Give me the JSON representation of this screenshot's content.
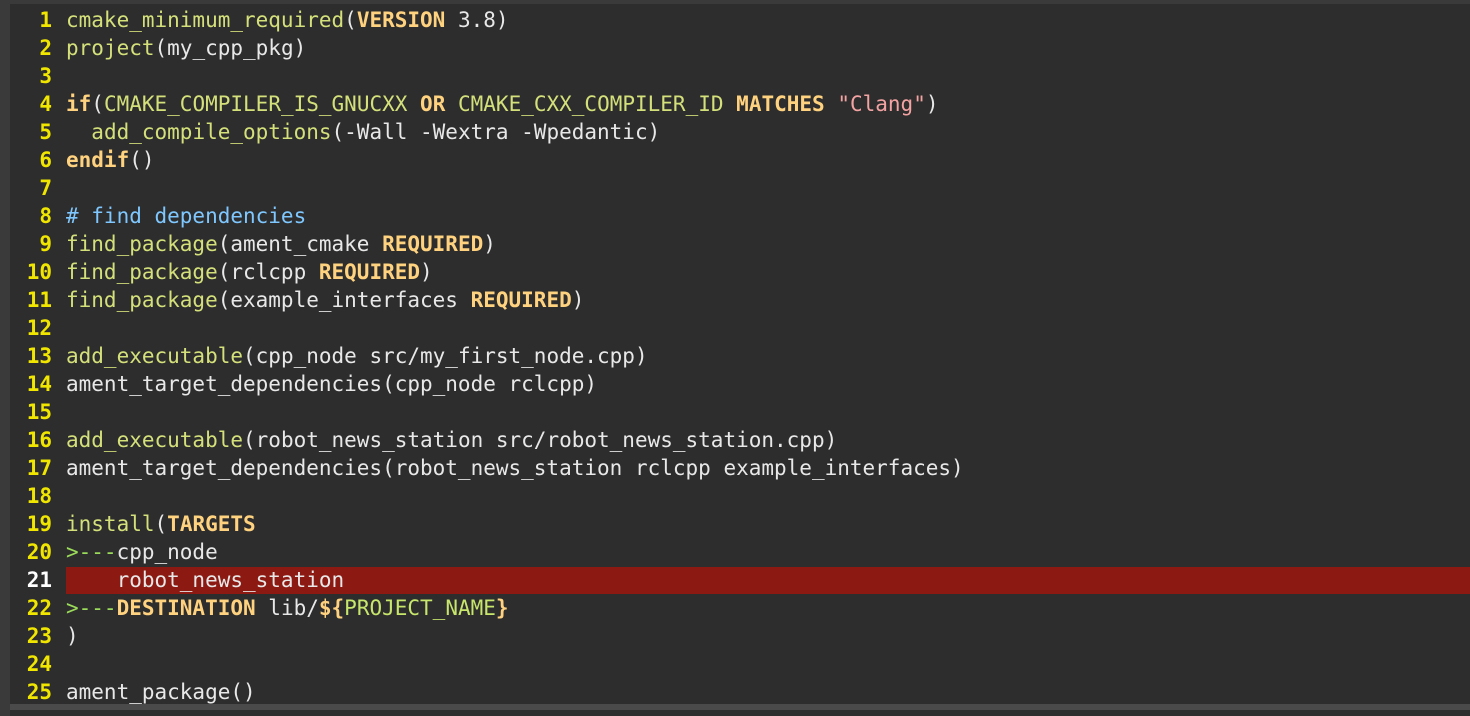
{
  "editor": {
    "language": "cmake",
    "highlighted_line": 21,
    "colors": {
      "background": "#2d2d2d",
      "line_number": "#f0e600",
      "function": "#d4e07a",
      "keyword": "#ffd27f",
      "string": "#f4a3a3",
      "comment": "#7fc8ff",
      "highlight": "#8c1a13"
    },
    "lines": [
      {
        "n": "1",
        "segments": [
          {
            "t": "cmake_minimum_required",
            "c": "fn"
          },
          {
            "t": "(",
            "c": "plain"
          },
          {
            "t": "VERSION",
            "c": "kw"
          },
          {
            "t": " 3.8)",
            "c": "plain"
          }
        ]
      },
      {
        "n": "2",
        "segments": [
          {
            "t": "project",
            "c": "fn"
          },
          {
            "t": "(my_cpp_pkg)",
            "c": "plain"
          }
        ]
      },
      {
        "n": "3",
        "segments": []
      },
      {
        "n": "4",
        "segments": [
          {
            "t": "if",
            "c": "kw"
          },
          {
            "t": "(",
            "c": "plain"
          },
          {
            "t": "CMAKE_COMPILER_IS_GNUCXX",
            "c": "fn"
          },
          {
            "t": " ",
            "c": "plain"
          },
          {
            "t": "OR",
            "c": "kw"
          },
          {
            "t": " ",
            "c": "plain"
          },
          {
            "t": "CMAKE_CXX_COMPILER_ID",
            "c": "fn"
          },
          {
            "t": " ",
            "c": "plain"
          },
          {
            "t": "MATCHES",
            "c": "kw"
          },
          {
            "t": " ",
            "c": "plain"
          },
          {
            "t": "\"Clang\"",
            "c": "str"
          },
          {
            "t": ")",
            "c": "plain"
          }
        ]
      },
      {
        "n": "5",
        "segments": [
          {
            "t": "  ",
            "c": "plain"
          },
          {
            "t": "add_compile_options",
            "c": "fn"
          },
          {
            "t": "(-Wall -Wextra -Wpedantic)",
            "c": "plain"
          }
        ]
      },
      {
        "n": "6",
        "segments": [
          {
            "t": "endif",
            "c": "kw"
          },
          {
            "t": "()",
            "c": "plain"
          }
        ]
      },
      {
        "n": "7",
        "segments": []
      },
      {
        "n": "8",
        "segments": [
          {
            "t": "# find dependencies",
            "c": "cm"
          }
        ]
      },
      {
        "n": "9",
        "segments": [
          {
            "t": "find_package",
            "c": "fn"
          },
          {
            "t": "(ament_cmake ",
            "c": "plain"
          },
          {
            "t": "REQUIRED",
            "c": "kw"
          },
          {
            "t": ")",
            "c": "plain"
          }
        ]
      },
      {
        "n": "10",
        "segments": [
          {
            "t": "find_package",
            "c": "fn"
          },
          {
            "t": "(rclcpp ",
            "c": "plain"
          },
          {
            "t": "REQUIRED",
            "c": "kw"
          },
          {
            "t": ")",
            "c": "plain"
          }
        ]
      },
      {
        "n": "11",
        "segments": [
          {
            "t": "find_package",
            "c": "fn"
          },
          {
            "t": "(example_interfaces ",
            "c": "plain"
          },
          {
            "t": "REQUIRED",
            "c": "kw"
          },
          {
            "t": ")",
            "c": "plain"
          }
        ]
      },
      {
        "n": "12",
        "segments": []
      },
      {
        "n": "13",
        "segments": [
          {
            "t": "add_executable",
            "c": "fn"
          },
          {
            "t": "(cpp_node src/my_first_node.cpp)",
            "c": "plain"
          }
        ]
      },
      {
        "n": "14",
        "segments": [
          {
            "t": "ament_target_dependencies(cpp_node rclcpp)",
            "c": "plain"
          }
        ]
      },
      {
        "n": "15",
        "segments": []
      },
      {
        "n": "16",
        "segments": [
          {
            "t": "add_executable",
            "c": "fn"
          },
          {
            "t": "(robot_news_station src/robot_news_station.cpp)",
            "c": "plain"
          }
        ]
      },
      {
        "n": "17",
        "segments": [
          {
            "t": "ament_target_dependencies(robot_news_station rclcpp example_interfaces)",
            "c": "plain"
          }
        ]
      },
      {
        "n": "18",
        "segments": []
      },
      {
        "n": "19",
        "segments": [
          {
            "t": "install",
            "c": "fn"
          },
          {
            "t": "(",
            "c": "plain"
          },
          {
            "t": "TARGETS",
            "c": "kw"
          }
        ]
      },
      {
        "n": "20",
        "segments": [
          {
            "t": ">---",
            "c": "tab"
          },
          {
            "t": "cpp_node",
            "c": "plain"
          }
        ]
      },
      {
        "n": "21",
        "segments": [
          {
            "t": "    robot_news_station",
            "c": "plain"
          }
        ]
      },
      {
        "n": "22",
        "segments": [
          {
            "t": ">---",
            "c": "tab"
          },
          {
            "t": "DESTINATION",
            "c": "kw"
          },
          {
            "t": " lib/",
            "c": "plain"
          },
          {
            "t": "${",
            "c": "kw"
          },
          {
            "t": "PROJECT_NAME",
            "c": "var"
          },
          {
            "t": "}",
            "c": "kw"
          }
        ]
      },
      {
        "n": "23",
        "segments": [
          {
            "t": ")",
            "c": "plain"
          }
        ]
      },
      {
        "n": "24",
        "segments": []
      },
      {
        "n": "25",
        "segments": [
          {
            "t": "ament_package()",
            "c": "plain"
          }
        ]
      }
    ]
  }
}
